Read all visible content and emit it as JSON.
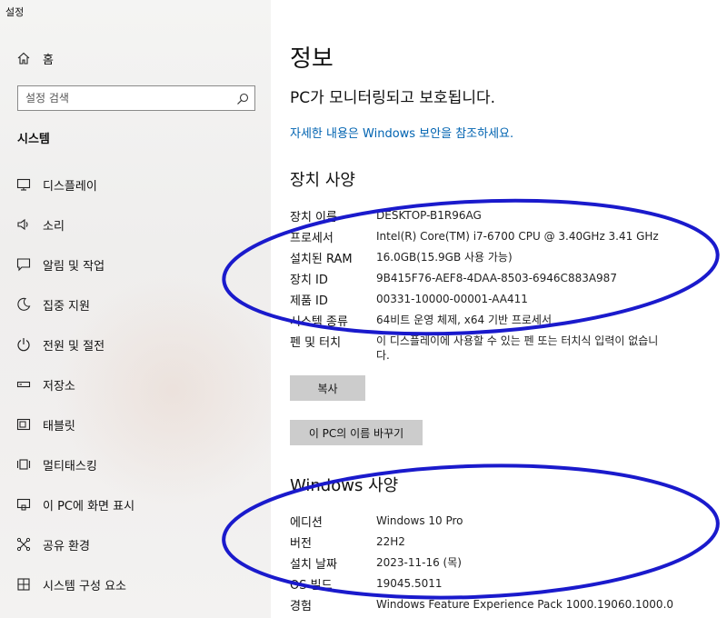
{
  "window": {
    "title": "설정"
  },
  "sidebar": {
    "home": {
      "label": "홈",
      "icon": "home-icon"
    },
    "search": {
      "placeholder": "설정 검색",
      "icon": "search-icon"
    },
    "section_title": "시스템",
    "items": [
      {
        "label": "디스플레이",
        "icon": "display-icon"
      },
      {
        "label": "소리",
        "icon": "sound-icon"
      },
      {
        "label": "알림 및 작업",
        "icon": "notification-icon"
      },
      {
        "label": "집중 지원",
        "icon": "focus-assist-icon"
      },
      {
        "label": "전원 및 절전",
        "icon": "power-icon"
      },
      {
        "label": "저장소",
        "icon": "storage-icon"
      },
      {
        "label": "태블릿",
        "icon": "tablet-icon"
      },
      {
        "label": "멀티태스킹",
        "icon": "multitasking-icon"
      },
      {
        "label": "이 PC에 화면 표시",
        "icon": "project-icon"
      },
      {
        "label": "공유 환경",
        "icon": "shared-experiences-icon"
      },
      {
        "label": "시스템 구성 요소",
        "icon": "system-components-icon"
      }
    ]
  },
  "main": {
    "title": "정보",
    "protection_status": "PC가 모니터링되고 보호됩니다.",
    "security_link": "자세한 내용은 Windows 보안을 참조하세요.",
    "device_specs": {
      "heading": "장치 사양",
      "rows": [
        {
          "label": "장치 이름",
          "value": "DESKTOP-B1R96AG"
        },
        {
          "label": "프로세서",
          "value": "Intel(R) Core(TM) i7-6700 CPU @ 3.40GHz   3.41 GHz"
        },
        {
          "label": "설치된 RAM",
          "value": "16.0GB(15.9GB 사용 가능)"
        },
        {
          "label": "장치 ID",
          "value": "9B415F76-AEF8-4DAA-8503-6946C883A987"
        },
        {
          "label": "제품 ID",
          "value": "00331-10000-00001-AA411"
        },
        {
          "label": "시스템 종류",
          "value": "64비트 운영 체제, x64 기반 프로세서"
        },
        {
          "label": "펜 및 터치",
          "value": "이 디스플레이에 사용할 수 있는 펜 또는 터치식 입력이 없습니다."
        }
      ]
    },
    "copy_button": "복사",
    "rename_button": "이 PC의 이름 바꾸기",
    "windows_specs": {
      "heading": "Windows 사양",
      "rows": [
        {
          "label": "에디션",
          "value": "Windows 10 Pro"
        },
        {
          "label": "버전",
          "value": "22H2"
        },
        {
          "label": "설치 날짜",
          "value": "2023-11-16 (목)"
        },
        {
          "label": "OS 빌드",
          "value": "19045.5011"
        },
        {
          "label": "경험",
          "value": "Windows Feature Experience Pack 1000.19060.1000.0"
        }
      ]
    }
  },
  "colors": {
    "link": "#0063b1",
    "annotation": "#1a1acc",
    "button": "#cccccc"
  }
}
